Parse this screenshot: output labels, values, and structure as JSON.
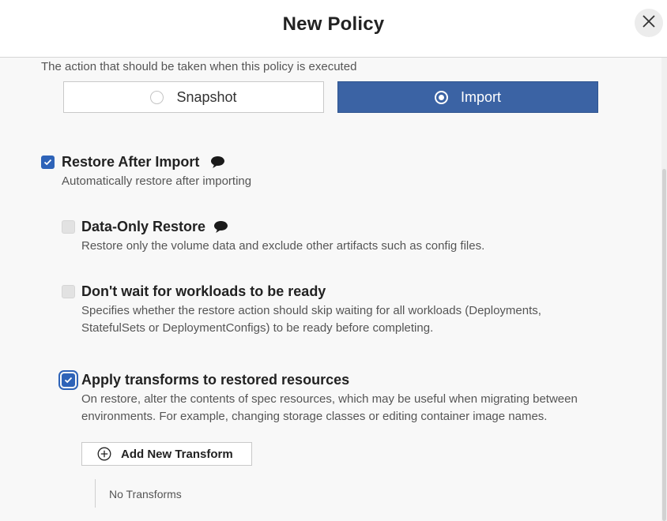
{
  "header": {
    "title": "New Policy",
    "close_icon": "close-icon"
  },
  "action": {
    "description": "The action that should be taken when this policy is executed",
    "options": [
      {
        "label": "Snapshot",
        "selected": false
      },
      {
        "label": "Import",
        "selected": true
      }
    ]
  },
  "options": {
    "restore_after_import": {
      "title": "Restore After Import",
      "description": "Automatically restore after importing",
      "checked": true,
      "icon": "comment-icon"
    },
    "data_only_restore": {
      "title": "Data-Only Restore",
      "description": "Restore only the volume data and exclude other artifacts such as config files.",
      "checked": false,
      "icon": "comment-icon"
    },
    "dont_wait": {
      "title": "Don't wait for workloads to be ready",
      "description_line1": "Specifies whether the restore action should skip waiting for all workloads (Deployments,",
      "description_line2": "StatefulSets or DeploymentConfigs) to be ready before completing.",
      "checked": false
    },
    "apply_transforms": {
      "title": "Apply transforms to restored resources",
      "description_line1": "On restore, alter the contents of spec resources, which may be useful when migrating between",
      "description_line2": "environments. For example, changing storage classes or editing container image names.",
      "checked": true,
      "focused": true
    }
  },
  "transforms": {
    "add_button_label": "Add New Transform",
    "add_icon": "plus-circle-icon",
    "empty_text": "No Transforms"
  },
  "colors": {
    "accent": "#3b63a4",
    "checkbox": "#2e63b8"
  }
}
